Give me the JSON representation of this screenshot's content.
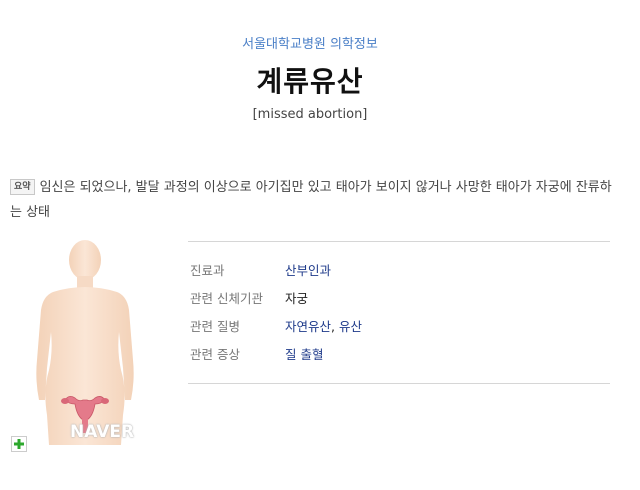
{
  "header": {
    "source": "서울대학교병원 의학정보",
    "title": "계류유산",
    "english_title": "[missed abortion]"
  },
  "summary": {
    "badge": "요약",
    "text": "임신은 되었으나, 발달 과정의 이상으로 아기집만 있고 태아가 보이지 않거나 사망한 태아가 자궁에 잔류하는 상태"
  },
  "figure": {
    "watermark": "NAVER",
    "expand_icon": "plus-icon",
    "colors": {
      "skin": "#f7dcc6",
      "organ": "#e47a8a",
      "expand": "#2ea82e"
    }
  },
  "info": {
    "rows": [
      {
        "label": "진료과",
        "value": "산부인과"
      },
      {
        "label": "관련 신체기관",
        "value": "자궁"
      },
      {
        "label": "관련 질병",
        "values": [
          "자연유산",
          "유산"
        ],
        "separator": ", "
      },
      {
        "label": "관련 증상",
        "value": "질 출혈"
      }
    ]
  },
  "colors": {
    "source_link": "#4a7fc7",
    "link": "#1e3a8a",
    "label": "#777777",
    "divider": "#d6d6d6"
  }
}
